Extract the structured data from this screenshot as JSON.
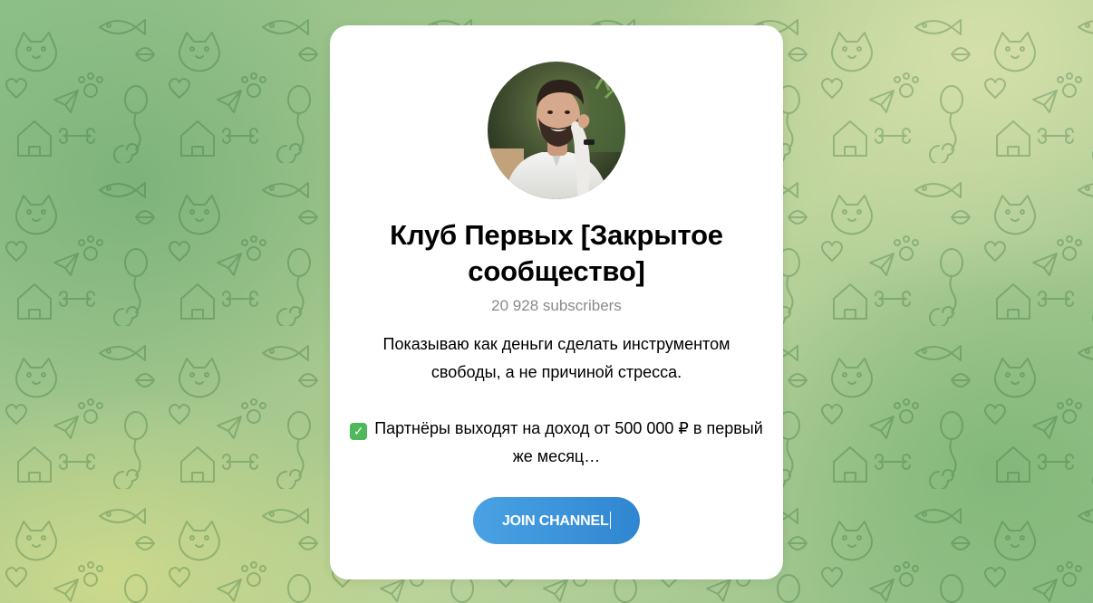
{
  "channel": {
    "title": "Клуб Первых [Закрытое сообщество]",
    "subscribers": "20 928 subscribers",
    "description_line1": "Показываю как деньги сделать инструментом свободы, а не причиной стресса.",
    "description_line2": "Партнёры выходят на доход от 500 000 ₽ в первый же месяц…",
    "check_icon": "white-check-mark-emoji"
  },
  "actions": {
    "join_label": "Join Channel"
  },
  "colors": {
    "button_start": "#4aa2e4",
    "button_end": "#2f86d0",
    "background_green": "#8fc08a",
    "background_yellow": "#d6e0aa",
    "subtitle_gray": "#8a8a8a"
  }
}
